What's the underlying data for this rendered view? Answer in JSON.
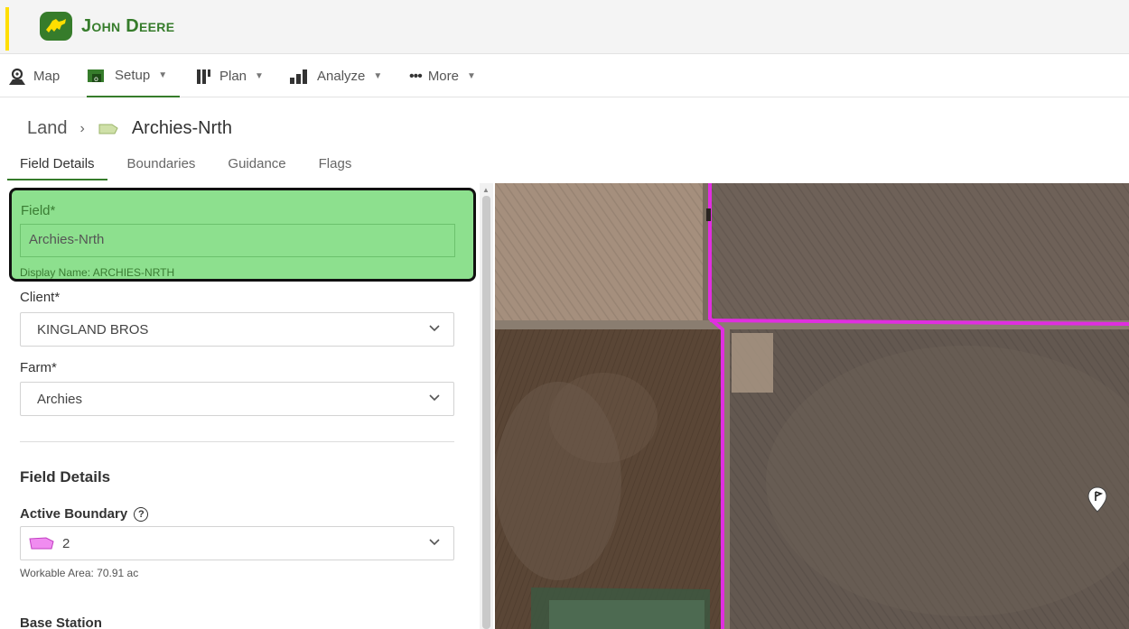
{
  "brand": {
    "name": "John Deere",
    "accent_color": "#ffde00",
    "brand_color": "#367c2b"
  },
  "nav": [
    {
      "label": "Map",
      "icon": "map-user-icon",
      "has_menu": false
    },
    {
      "label": "Setup",
      "icon": "setup-icon",
      "has_menu": true,
      "active": true
    },
    {
      "label": "Plan",
      "icon": "plan-icon",
      "has_menu": true
    },
    {
      "label": "Analyze",
      "icon": "analyze-icon",
      "has_menu": true
    },
    {
      "label": "More",
      "icon": "more-dots-icon",
      "has_menu": true
    }
  ],
  "breadcrumb": {
    "root": "Land",
    "current": "Archies-Nrth",
    "current_icon": "field-shape-icon"
  },
  "tabs": [
    {
      "label": "Field Details",
      "active": true
    },
    {
      "label": "Boundaries"
    },
    {
      "label": "Guidance"
    },
    {
      "label": "Flags"
    }
  ],
  "form": {
    "field_label": "Field*",
    "field_value": "Archies-Nrth",
    "display_name": "Display Name: ARCHIES-NRTH",
    "client_label": "Client*",
    "client_value": "KINGLAND BROS",
    "farm_label": "Farm*",
    "farm_value": "Archies",
    "section_title": "Field Details",
    "active_boundary_label": "Active Boundary",
    "active_boundary_value": "2",
    "workable_area": "Workable Area: 70.91 ac",
    "base_station_label": "Base Station"
  },
  "colors": {
    "highlight": "#8de08e",
    "boundary": "#e02ee0"
  }
}
